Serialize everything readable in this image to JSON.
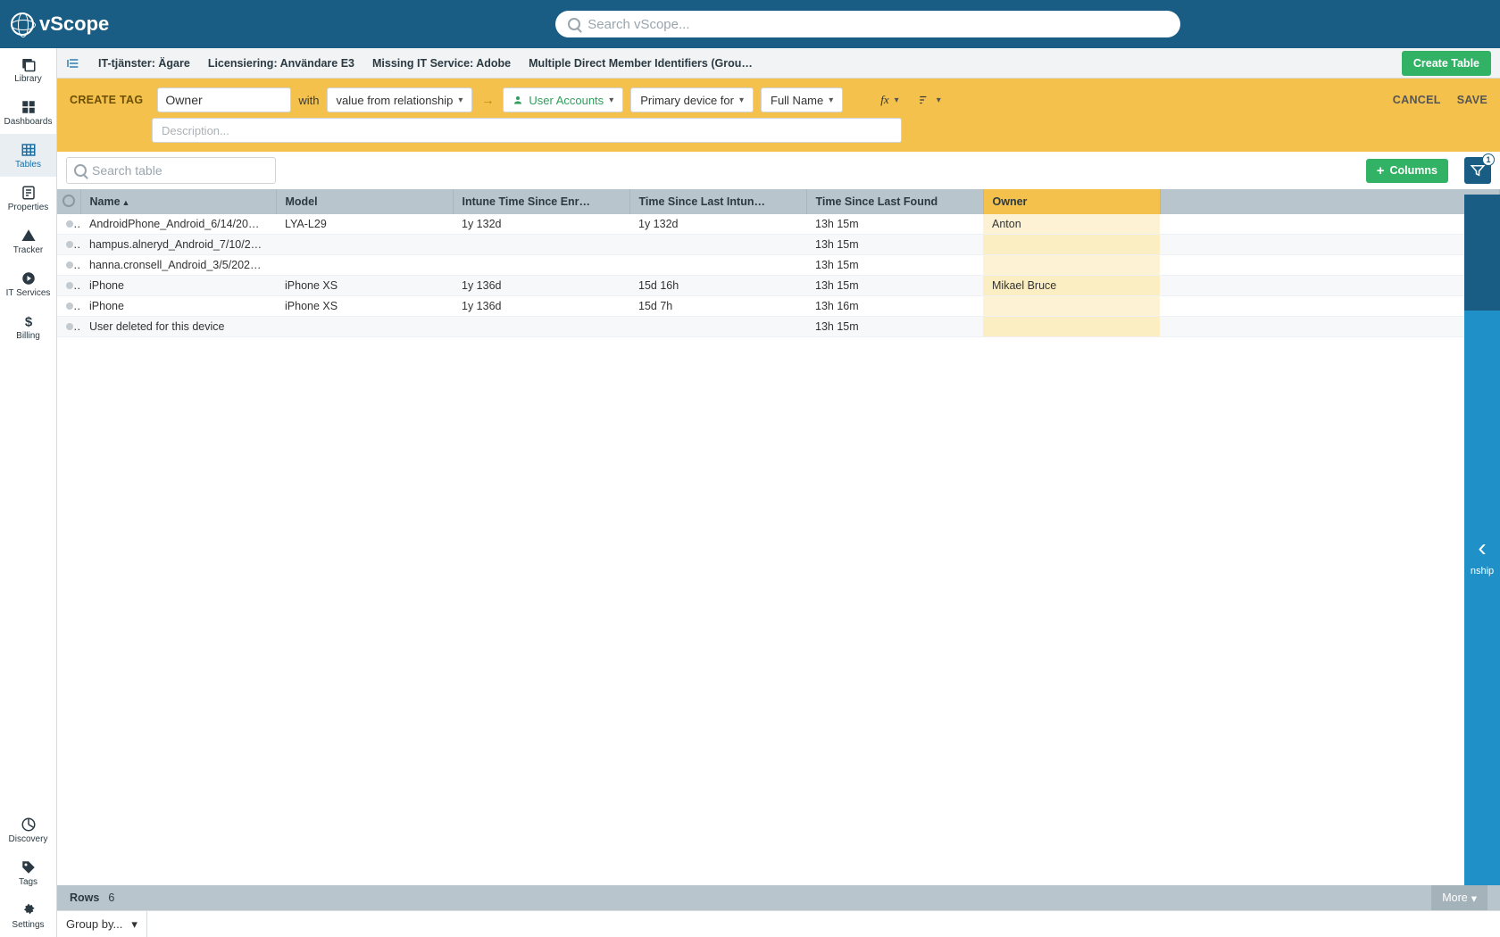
{
  "app_name": "vScope",
  "search_placeholder": "Search vScope...",
  "sidebar": {
    "top": [
      {
        "id": "library",
        "label": "Library"
      },
      {
        "id": "dashboards",
        "label": "Dashboards"
      },
      {
        "id": "tables",
        "label": "Tables"
      },
      {
        "id": "properties",
        "label": "Properties"
      },
      {
        "id": "tracker",
        "label": "Tracker"
      },
      {
        "id": "itservices",
        "label": "IT Services"
      },
      {
        "id": "billing",
        "label": "Billing"
      }
    ],
    "bottom": [
      {
        "id": "discovery",
        "label": "Discovery"
      },
      {
        "id": "tags",
        "label": "Tags"
      },
      {
        "id": "settings",
        "label": "Settings"
      }
    ]
  },
  "tabs": [
    "IT-tjänster: Ägare",
    "Licensiering: Användare E3",
    "Missing IT Service: Adobe",
    "Multiple Direct Member Identifiers (Grou…"
  ],
  "create_table_btn": "Create Table",
  "tag_builder": {
    "title": "CREATE TAG",
    "tag_name": "Owner",
    "with_label": "with",
    "source_type": "value from relationship",
    "resource": "User Accounts",
    "relation": "Primary device for",
    "field": "Full Name",
    "desc_placeholder": "Description...",
    "cancel": "CANCEL",
    "save": "SAVE"
  },
  "table_search_placeholder": "Search table",
  "columns_btn": "Columns",
  "filter_count": "1",
  "columns": [
    "Name",
    "Model",
    "Intune Time Since Enr…",
    "Time Since Last Intun…",
    "Time Since Last Found",
    "Owner"
  ],
  "rows": [
    {
      "name": "AndroidPhone_Android_6/14/20…",
      "model": "LYA-L29",
      "enr": "1y 132d",
      "sync": "1y 132d",
      "found": "13h 15m",
      "owner": "Anton"
    },
    {
      "name": "hampus.alneryd_Android_7/10/2…",
      "model": "",
      "enr": "",
      "sync": "",
      "found": "13h 15m",
      "owner": ""
    },
    {
      "name": "hanna.cronsell_Android_3/5/202…",
      "model": "",
      "enr": "",
      "sync": "",
      "found": "13h 15m",
      "owner": ""
    },
    {
      "name": "iPhone",
      "model": "iPhone XS",
      "enr": "1y 136d",
      "sync": "15d 16h",
      "found": "13h 15m",
      "owner": "Mikael Bruce"
    },
    {
      "name": "iPhone",
      "model": "iPhone XS",
      "enr": "1y 136d",
      "sync": "15d 7h",
      "found": "13h 16m",
      "owner": ""
    },
    {
      "name": "User deleted for this device",
      "model": "",
      "enr": "",
      "sync": "",
      "found": "13h 15m",
      "owner": ""
    }
  ],
  "footer": {
    "rows_label": "Rows",
    "rows_count": "6",
    "more": "More",
    "groupby": "Group by..."
  },
  "right_panel_hint": "nship"
}
